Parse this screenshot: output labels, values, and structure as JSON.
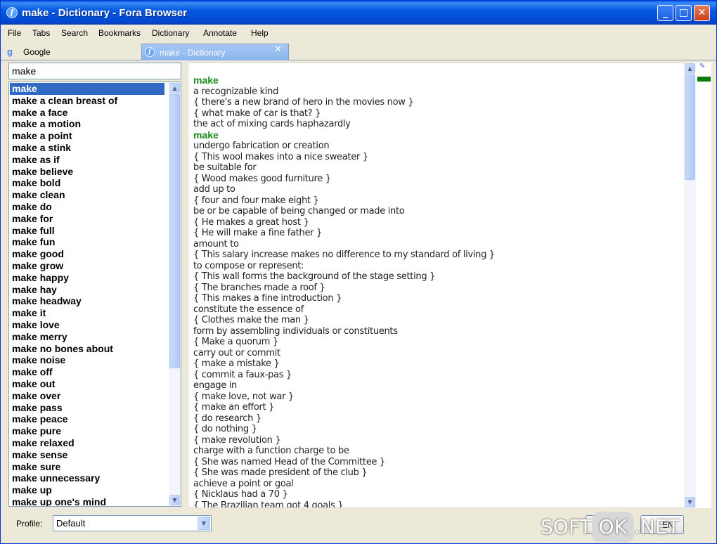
{
  "window": {
    "title": "make - Dictionary - Fora Browser",
    "app_icon": "fora-icon"
  },
  "menubar": [
    "File",
    "Tabs",
    "Search",
    "Bookmarks",
    "Dictionary",
    "Annotate",
    "Help"
  ],
  "tabs": [
    {
      "label": "Google",
      "icon": "google-icon"
    },
    {
      "label": "make - Dictionary",
      "icon": "fora-icon",
      "active": true
    }
  ],
  "search": {
    "value": "make"
  },
  "word_list": {
    "selected": "make",
    "items": [
      "make",
      "make a clean breast of",
      "make a face",
      "make a motion",
      "make a point",
      "make a stink",
      "make as if",
      "make believe",
      "make bold",
      "make clean",
      "make do",
      "make for",
      "make full",
      "make fun",
      "make good",
      "make grow",
      "make happy",
      "make hay",
      "make headway",
      "make it",
      "make love",
      "make merry",
      "make no bones about",
      "make noise",
      "make off",
      "make out",
      "make over",
      "make pass",
      "make peace",
      "make pure",
      "make relaxed",
      "make sense",
      "make sure",
      "make unnecessary",
      "make up",
      "make up one's mind"
    ]
  },
  "definition": {
    "lines": [
      {
        "t": "make",
        "h": true
      },
      {
        "t": "a recognizable kind"
      },
      {
        "t": "{ there's a new brand of hero in the movies now }"
      },
      {
        "t": "{ what make of car is that? }"
      },
      {
        "t": "the act of mixing cards haphazardly"
      },
      {
        "t": "make",
        "h": true
      },
      {
        "t": "undergo fabrication or creation"
      },
      {
        "t": "{ This wool makes into a nice sweater }"
      },
      {
        "t": "be suitable for"
      },
      {
        "t": "{ Wood makes good furniture }"
      },
      {
        "t": "add up to"
      },
      {
        "t": "{ four and four make eight }"
      },
      {
        "t": "be or be capable of being changed or made into"
      },
      {
        "t": "{ He makes a great host }"
      },
      {
        "t": "{ He will make a fine father }"
      },
      {
        "t": "amount to"
      },
      {
        "t": "{ This salary increase makes no difference to my standard of living }"
      },
      {
        "t": "to compose or represent:"
      },
      {
        "t": "{ This wall forms the background of the stage setting }"
      },
      {
        "t": "{ The branches made a roof }"
      },
      {
        "t": "{ This makes a fine introduction }"
      },
      {
        "t": "constitute the essence of"
      },
      {
        "t": "{ Clothes make the man }"
      },
      {
        "t": "form by assembling individuals or constituents"
      },
      {
        "t": "{ Make a quorum }"
      },
      {
        "t": "carry out or commit"
      },
      {
        "t": "{ make a mistake }"
      },
      {
        "t": "{ commit a faux-pas }"
      },
      {
        "t": "engage in"
      },
      {
        "t": "{ make love, not war }"
      },
      {
        "t": "{ make an effort }"
      },
      {
        "t": "{ do research }"
      },
      {
        "t": "{ do nothing }"
      },
      {
        "t": "{ make revolution }"
      },
      {
        "t": "charge with a function charge to be"
      },
      {
        "t": "{ She was named Head of the Committee }"
      },
      {
        "t": "{ She was made president of the club }"
      },
      {
        "t": "achieve a point or goal"
      },
      {
        "t": "{ Nicklaus had a 70 }"
      },
      {
        "t": "{ The Brazilian team got 4 goals }"
      }
    ]
  },
  "bottom": {
    "profile_label": "Profile:",
    "profile_value": "Default",
    "button_label": "EN"
  },
  "watermark": {
    "pre": "SOFT",
    "pill": "OK",
    "post": ".NET"
  },
  "colors": {
    "titlebar": "#0349d3",
    "selection": "#316ac5",
    "headword": "#1a8a1a"
  }
}
